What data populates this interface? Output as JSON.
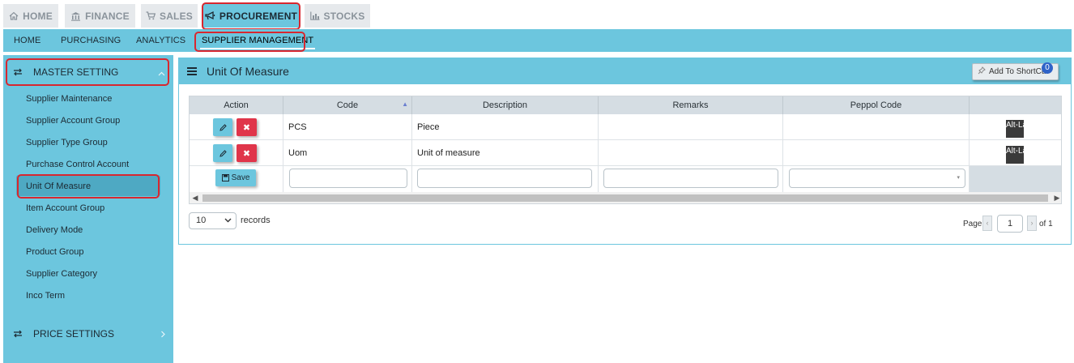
{
  "top_tabs": [
    {
      "label": "HOME",
      "icon": "home-icon"
    },
    {
      "label": "FINANCE",
      "icon": "bank-icon"
    },
    {
      "label": "SALES",
      "icon": "cart-icon"
    },
    {
      "label": "PROCUREMENT",
      "icon": "megaphone-icon",
      "active": true
    },
    {
      "label": "STOCKS",
      "icon": "bar-chart-icon"
    }
  ],
  "sub_nav": [
    "HOME",
    "PURCHASING",
    "ANALYTICS",
    "SUPPLIER MANAGEMENT"
  ],
  "sidebar": {
    "master_setting": "MASTER SETTING",
    "items": [
      "Supplier Maintenance",
      "Supplier Account Group",
      "Supplier Type Group",
      "Purchase Control Account",
      "Unit Of Measure",
      "Item Account Group",
      "Delivery Mode",
      "Product Group",
      "Supplier Category",
      "Inco Term"
    ],
    "price_settings": "PRICE SETTINGS"
  },
  "panel": {
    "title": "Unit Of Measure",
    "shortcut_label": "Add To ShortCut",
    "shortcut_count": "0"
  },
  "grid": {
    "columns": [
      "Action",
      "Code",
      "Description",
      "Remarks",
      "Peppol Code"
    ],
    "rows": [
      {
        "code": "PCS",
        "description": "Piece",
        "remarks": "",
        "peppol": "",
        "alt_lang": "Alt-Lang"
      },
      {
        "code": "Uom",
        "description": "Unit of measure",
        "remarks": "",
        "peppol": "",
        "alt_lang": "Alt-Lang"
      }
    ],
    "save_label": "Save"
  },
  "footer": {
    "records_value": "10",
    "records_label": "records",
    "page_label": "Page",
    "page_value": "1",
    "of_label": "of 1"
  },
  "colors": {
    "accent": "#6cc6de",
    "highlight_outline": "#d8272f",
    "delete_red": "#e0354a"
  }
}
